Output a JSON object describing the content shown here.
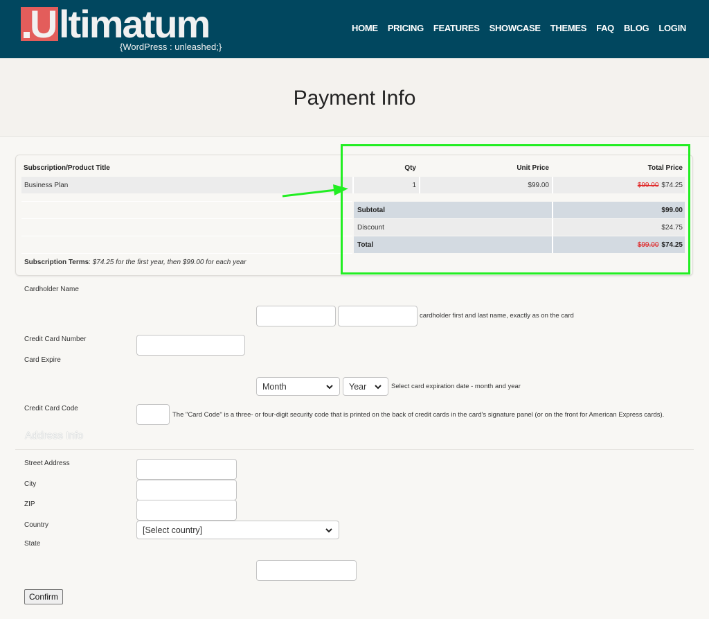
{
  "header": {
    "logo_text_u": "U",
    "logo_text_rest": "ltimatum",
    "logo_tagline": "{WordPress : unleashed;}",
    "nav": [
      "HOME",
      "PRICING",
      "FEATURES",
      "SHOWCASE",
      "THEMES",
      "FAQ",
      "BLOG",
      "LOGIN"
    ]
  },
  "page": {
    "title": "Payment Info"
  },
  "order": {
    "headers": {
      "title": "Subscription/Product Title",
      "qty": "Qty",
      "unit_price": "Unit Price",
      "total_price": "Total Price"
    },
    "item": {
      "title": "Business Plan",
      "qty": "1",
      "unit_price": "$99.00",
      "total_old": "$99.00",
      "total_new": "$74.25"
    },
    "subtotal": {
      "label": "Subtotal",
      "value": "$99.00"
    },
    "discount": {
      "label": "Discount",
      "value": "$24.75"
    },
    "total": {
      "label": "Total",
      "old": "$99.00",
      "new": "$74.25"
    },
    "terms_label": "Subscription Terms",
    "terms_text": ": ",
    "terms_value": "$74.25 for the first year, then $99.00 for each year"
  },
  "annotation": {
    "highlight_color": "#22ee22"
  },
  "form": {
    "cardholder_name_label": "Cardholder Name",
    "cardholder_hint": "cardholder first and last name, exactly as on the card",
    "first_name_value": "",
    "last_name_value": "",
    "card_number_label": "Credit Card Number",
    "card_number_value": "",
    "card_expire_label": "Card Expire",
    "month_select": "Month",
    "year_select": "Year",
    "expire_hint": "Select card expiration date - month and year",
    "card_code_label": "Credit Card Code",
    "card_code_value": "",
    "card_code_hint": "The \"Card Code\" is a three- or four-digit security code that is printed on the back of credit cards in the card's signature panel (or on the front for American Express cards).",
    "address_section_title": "Address Info",
    "street_label": "Street Address",
    "city_label": "City",
    "zip_label": "ZIP",
    "country_label": "Country",
    "country_select": "[Select country]",
    "state_label": "State",
    "confirm_label": "Confirm"
  },
  "colors": {
    "header_bg": "#01475f",
    "logo_red": "#e35d5b",
    "strike_red": "#e01d1d",
    "summary_blue": "#d3dae1"
  }
}
